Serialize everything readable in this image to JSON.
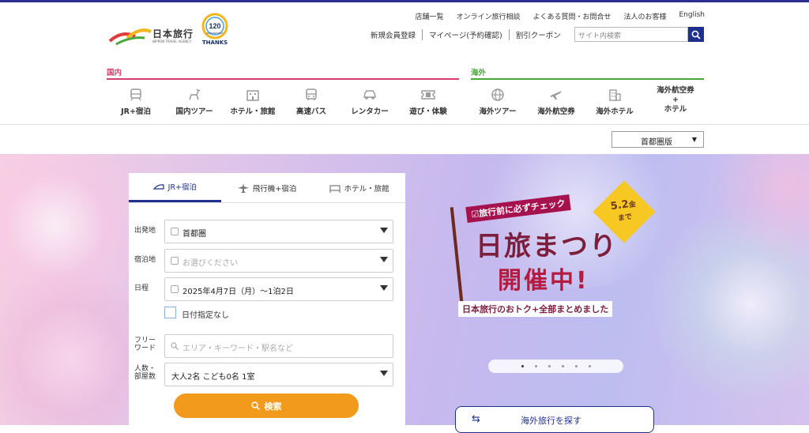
{
  "colors": {
    "brand": "#2f2e8c",
    "domestic": "#d63d6e",
    "overseas": "#4aa63b",
    "search_button": "#f29a1c",
    "accent_blue": "#1d2f8f"
  },
  "brand": {
    "name": "日本旅行",
    "sub": "NIPPON TRAVEL AGENCY",
    "anniversary_num": "120",
    "anniversary_text": "ANNIVERSARY",
    "thanks": "THANKS"
  },
  "top_links": [
    "店舗一覧",
    "オンライン旅行相談",
    "よくある質問・お問合せ",
    "法人のお客様",
    "English"
  ],
  "sub_links": [
    "新規会員登録",
    "マイページ(予約確認)",
    "割引クーポン"
  ],
  "search": {
    "placeholder": "サイト内検索"
  },
  "sections": {
    "domestic": "国内",
    "overseas": "海外"
  },
  "nav_domestic": [
    {
      "label": "JR+宿泊",
      "icon": "train-icon"
    },
    {
      "label": "国内ツアー",
      "icon": "deer-icon"
    },
    {
      "label": "ホテル・旅館",
      "icon": "hotel-icon"
    },
    {
      "label": "高速バス",
      "icon": "bus-icon"
    },
    {
      "label": "レンタカー",
      "icon": "car-icon"
    },
    {
      "label": "遊び・体験",
      "icon": "ticket-icon"
    }
  ],
  "nav_overseas": [
    {
      "label": "海外ツアー",
      "icon": "globe-icon"
    },
    {
      "label": "海外航空券",
      "icon": "plane-icon"
    },
    {
      "label": "海外ホテル",
      "icon": "building-icon"
    },
    {
      "label": "海外航空券\n+\nホテル",
      "icon": ""
    }
  ],
  "region_select": {
    "value": "首都圏版"
  },
  "booking": {
    "tabs": [
      "JR+宿泊",
      "飛行機+宿泊",
      "ホテル・旅館"
    ],
    "departure": {
      "label": "出発地",
      "value": "首都圏"
    },
    "stay": {
      "label": "宿泊地",
      "placeholder": "お選びください"
    },
    "date": {
      "label": "日程",
      "value": "2025年4月7日（月）〜1泊2日"
    },
    "no_date": "日付指定なし",
    "freeword": {
      "label_1": "フリー",
      "label_2": "ワード",
      "placeholder": "エリア・キーワード・駅名など"
    },
    "people": {
      "label_1": "人数・",
      "label_2": "部屋数",
      "value": "大人2名 こども0名 1室"
    },
    "search_button": "検索"
  },
  "banner": {
    "check": "旅行前に必ずチェック",
    "date_1": "5.2",
    "date_2": "金",
    "date_3": "まで",
    "title": "日旅まつり",
    "title2": "開催中!",
    "sub": "日本旅行のおトク+全部まとめました"
  },
  "carousel": {
    "count": 6,
    "active": 0
  },
  "overseas_button": "海外旅行を探す"
}
